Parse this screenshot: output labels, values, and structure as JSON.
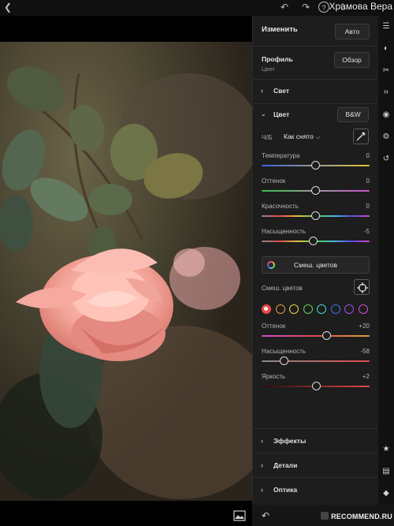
{
  "watermark": {
    "top": "Храмова Вера",
    "bottom": "RECOMMEND.RU"
  },
  "panel": {
    "title": "Изменить",
    "auto_button": "Авто",
    "profile_label": "Профиль",
    "profile_value": "Цвет",
    "browse_button": "Обзор"
  },
  "sections": {
    "light": "Свет",
    "color": "Цвет",
    "effects": "Эффекты",
    "details": "Детали",
    "optics": "Оптика"
  },
  "color": {
    "bw_button": "B&W",
    "treatment_label": "Ч/Б",
    "treatment_value": "Как снято",
    "sliders": [
      {
        "label": "Температура",
        "value": "0",
        "level": 0.5
      },
      {
        "label": "Оттенок",
        "value": "0",
        "level": 0.5
      },
      {
        "label": "Красочность",
        "value": "0",
        "level": 0.5
      },
      {
        "label": "Насыщенность",
        "value": "-5",
        "level": 0.475
      }
    ],
    "mix_button": "Смеш. цветов",
    "mix_label": "Смеш. цветов",
    "swatch_colors": [
      "#e84b4b",
      "#e89a3c",
      "#e8d24b",
      "#5fd25f",
      "#4bd2d2",
      "#4b6be8",
      "#a04be8",
      "#d24bd2"
    ],
    "selected_swatch": 0,
    "mix_sliders": [
      {
        "label": "Оттенок",
        "value": "+20",
        "level": 0.6
      },
      {
        "label": "Насыщенность",
        "value": "-58",
        "level": 0.21
      },
      {
        "label": "Яркость",
        "value": "+2",
        "level": 0.51
      }
    ]
  },
  "icons": {
    "back": "chevron-left-icon",
    "undo": "undo-icon",
    "redo": "redo-icon",
    "help": "help-icon",
    "share": "share-icon",
    "strip": [
      "sliders-icon",
      "masking-icon",
      "heal-icon",
      "crop-icon",
      "presets-icon",
      "versions-icon",
      "history-icon",
      "star-icon",
      "comment-icon",
      "tag-icon"
    ]
  }
}
